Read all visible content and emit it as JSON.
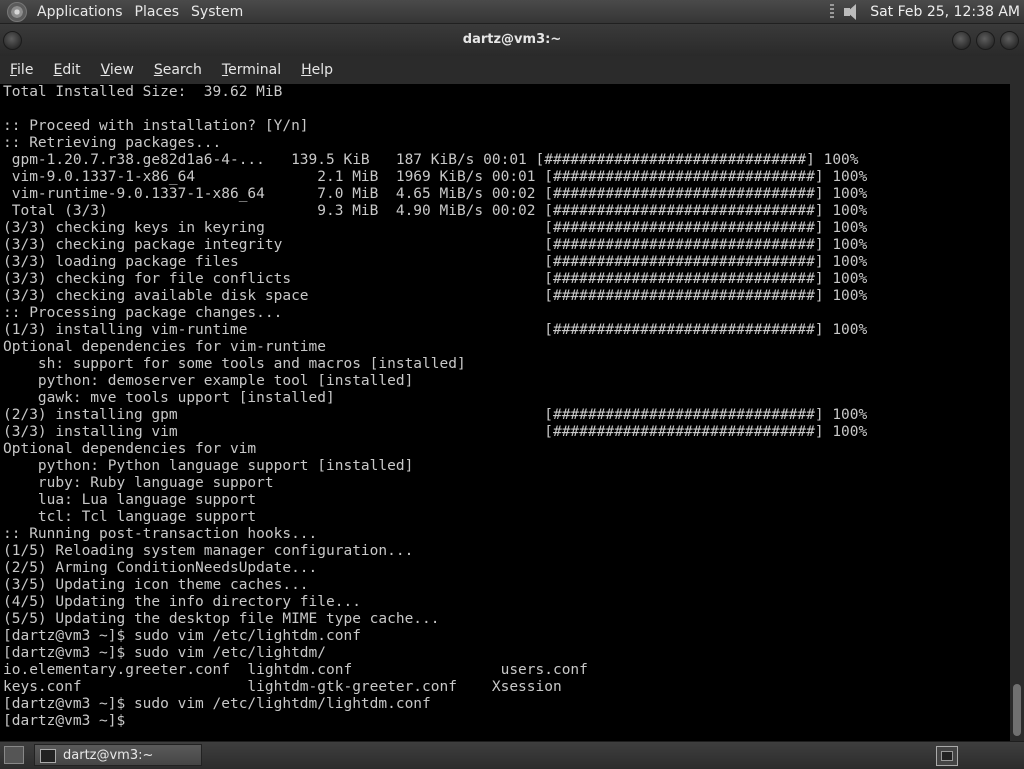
{
  "top_panel": {
    "menus": [
      "Applications",
      "Places",
      "System"
    ],
    "clock": "Sat Feb 25, 12:38 AM"
  },
  "window": {
    "title": "dartz@vm3:~"
  },
  "menubar": {
    "items": [
      {
        "u": "F",
        "rest": "ile"
      },
      {
        "u": "E",
        "rest": "dit"
      },
      {
        "u": "V",
        "rest": "iew"
      },
      {
        "u": "S",
        "rest": "earch"
      },
      {
        "u": "T",
        "rest": "erminal"
      },
      {
        "u": "H",
        "rest": "elp"
      }
    ]
  },
  "terminal": {
    "lines": [
      "Total Installed Size:  39.62 MiB",
      "",
      ":: Proceed with installation? [Y/n]",
      ":: Retrieving packages...",
      " gpm-1.20.7.r38.ge82d1a6-4-...   139.5 KiB   187 KiB/s 00:01 [##############################] 100%",
      " vim-9.0.1337-1-x86_64              2.1 MiB  1969 KiB/s 00:01 [##############################] 100%",
      " vim-runtime-9.0.1337-1-x86_64      7.0 MiB  4.65 MiB/s 00:02 [##############################] 100%",
      " Total (3/3)                        9.3 MiB  4.90 MiB/s 00:02 [##############################] 100%",
      "(3/3) checking keys in keyring                                [##############################] 100%",
      "(3/3) checking package integrity                              [##############################] 100%",
      "(3/3) loading package files                                   [##############################] 100%",
      "(3/3) checking for file conflicts                             [##############################] 100%",
      "(3/3) checking available disk space                           [##############################] 100%",
      ":: Processing package changes...",
      "(1/3) installing vim-runtime                                  [##############################] 100%",
      "Optional dependencies for vim-runtime",
      "    sh: support for some tools and macros [installed]",
      "    python: demoserver example tool [installed]",
      "    gawk: mve tools upport [installed]",
      "(2/3) installing gpm                                          [##############################] 100%",
      "(3/3) installing vim                                          [##############################] 100%",
      "Optional dependencies for vim",
      "    python: Python language support [installed]",
      "    ruby: Ruby language support",
      "    lua: Lua language support",
      "    tcl: Tcl language support",
      ":: Running post-transaction hooks...",
      "(1/5) Reloading system manager configuration...",
      "(2/5) Arming ConditionNeedsUpdate...",
      "(3/5) Updating icon theme caches...",
      "(4/5) Updating the info directory file...",
      "(5/5) Updating the desktop file MIME type cache...",
      "[dartz@vm3 ~]$ sudo vim /etc/lightdm.conf",
      "[dartz@vm3 ~]$ sudo vim /etc/lightdm/",
      "io.elementary.greeter.conf  lightdm.conf                 users.conf",
      "keys.conf                   lightdm-gtk-greeter.conf    Xsession",
      "[dartz@vm3 ~]$ sudo vim /etc/lightdm/lightdm.conf",
      "[dartz@vm3 ~]$"
    ]
  },
  "taskbar": {
    "task_label": "dartz@vm3:~"
  }
}
